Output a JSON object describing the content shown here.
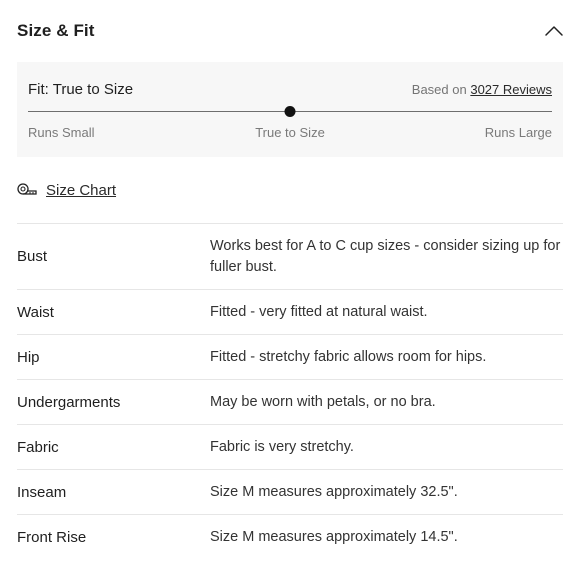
{
  "header": {
    "title": "Size & Fit",
    "toggle_icon": "chevron-up-icon"
  },
  "fit": {
    "title": "Fit: True to Size",
    "based_on_prefix": "Based on",
    "reviews_link": "3027 Reviews",
    "scale_left": "Runs Small",
    "scale_mid": "True to Size",
    "scale_right": "Runs Large",
    "marker_position": 0.5
  },
  "size_chart": {
    "label": "Size Chart",
    "icon": "measuring-tape-icon"
  },
  "specs": [
    {
      "name": "Bust",
      "value": "Works best for A to C cup sizes - consider sizing up for fuller bust."
    },
    {
      "name": "Waist",
      "value": "Fitted - very fitted at natural waist."
    },
    {
      "name": "Hip",
      "value": "Fitted - stretchy fabric allows room for hips."
    },
    {
      "name": "Undergarments",
      "value": "May be worn with petals, or no bra."
    },
    {
      "name": "Fabric",
      "value": "Fabric is very stretchy."
    },
    {
      "name": "Inseam",
      "value": "Size M measures approximately 32.5\"."
    },
    {
      "name": "Front Rise",
      "value": "Size M measures approximately 14.5\"."
    }
  ],
  "colors": {
    "fit_box_bg": "#f7f7f7",
    "divider": "#e6e6e6",
    "marker": "#111111"
  }
}
